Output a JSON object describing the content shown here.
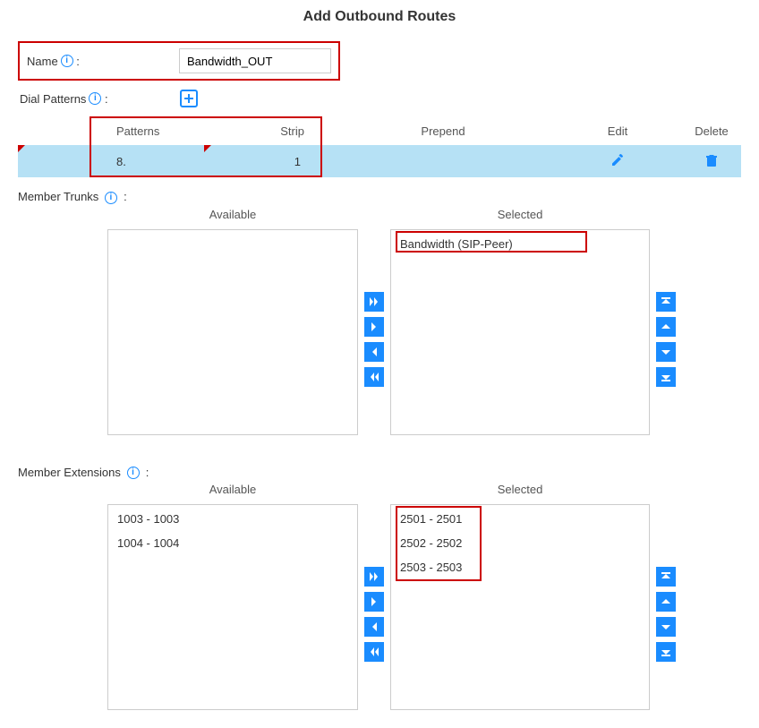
{
  "title": "Add Outbound Routes",
  "name_field": {
    "label": "Name",
    "value": "Bandwidth_OUT"
  },
  "dial_patterns": {
    "label": "Dial Patterns",
    "headers": {
      "patterns": "Patterns",
      "strip": "Strip",
      "prepend": "Prepend",
      "edit": "Edit",
      "delete": "Delete"
    },
    "row": {
      "pattern": "8.",
      "strip": "1",
      "prepend": ""
    }
  },
  "member_trunks": {
    "label": "Member Trunks",
    "available_header": "Available",
    "selected_header": "Selected",
    "available": [],
    "selected": [
      "Bandwidth (SIP-Peer)"
    ]
  },
  "member_extensions": {
    "label": "Member Extensions",
    "available_header": "Available",
    "selected_header": "Selected",
    "available": [
      "1003 - 1003",
      "1004 - 1004"
    ],
    "selected": [
      "2501 - 2501",
      "2502 - 2502",
      "2503 - 2503"
    ]
  }
}
